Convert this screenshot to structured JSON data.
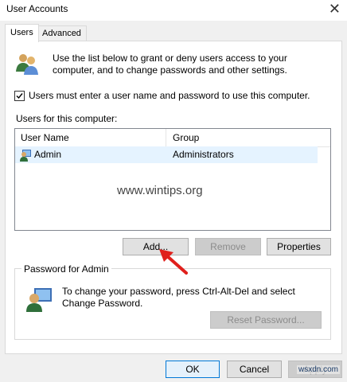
{
  "window": {
    "title": "User Accounts",
    "close_glyph": "✕"
  },
  "tabs": [
    {
      "label": "Users",
      "active": true
    },
    {
      "label": "Advanced",
      "active": false
    }
  ],
  "users_tab": {
    "intro": "Use the list below to grant or deny users access to your computer, and to change passwords and other settings.",
    "require_password_checkbox": {
      "label": "Users must enter a user name and password to use this computer.",
      "checked": true
    },
    "list_label": "Users for this computer:",
    "columns": [
      "User Name",
      "Group"
    ],
    "rows": [
      {
        "user_name": "Admin",
        "group": "Administrators",
        "selected": true
      }
    ],
    "buttons": {
      "add": "Add...",
      "remove": "Remove",
      "properties": "Properties"
    },
    "password_group": {
      "legend": "Password for Admin",
      "text": "To change your password, press Ctrl-Alt-Del and select Change Password.",
      "reset_button": "Reset Password..."
    }
  },
  "footer_buttons": {
    "ok": "OK",
    "cancel": "Cancel",
    "apply": "Apply"
  },
  "watermark": "www.wintips.org",
  "corner_watermark": "wsxdn.com",
  "icons": [
    "users-group-icon",
    "user-row-icon",
    "password-key-icon",
    "red-arrow-icon",
    "check-icon"
  ],
  "colors": {
    "selection": "#e5f3ff",
    "focus_border": "#0078d7",
    "arrow": "#e0201c"
  }
}
